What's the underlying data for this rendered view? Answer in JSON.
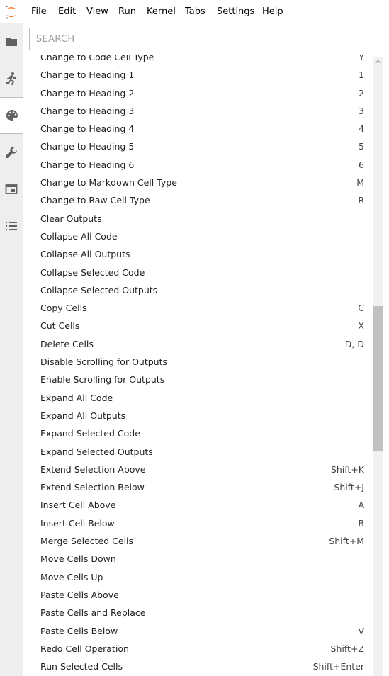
{
  "menubar": {
    "logo_icon": "jupyter-logo-icon",
    "items": [
      "File",
      "Edit",
      "View",
      "Run",
      "Kernel",
      "Tabs",
      "Settings",
      "Help"
    ]
  },
  "sidebar": {
    "tabs": [
      {
        "icon": "folder-icon"
      },
      {
        "icon": "running-icon"
      },
      {
        "icon": "palette-icon",
        "active": true
      },
      {
        "icon": "wrench-icon"
      },
      {
        "icon": "tabs-icon"
      },
      {
        "icon": "list-icon"
      }
    ]
  },
  "palette": {
    "search_placeholder": "SEARCH",
    "commands": [
      {
        "label": "Change to Code Cell Type",
        "shortcut": "Y"
      },
      {
        "label": "Change to Heading 1",
        "shortcut": "1"
      },
      {
        "label": "Change to Heading 2",
        "shortcut": "2"
      },
      {
        "label": "Change to Heading 3",
        "shortcut": "3"
      },
      {
        "label": "Change to Heading 4",
        "shortcut": "4"
      },
      {
        "label": "Change to Heading 5",
        "shortcut": "5"
      },
      {
        "label": "Change to Heading 6",
        "shortcut": "6"
      },
      {
        "label": "Change to Markdown Cell Type",
        "shortcut": "M"
      },
      {
        "label": "Change to Raw Cell Type",
        "shortcut": "R"
      },
      {
        "label": "Clear Outputs",
        "shortcut": ""
      },
      {
        "label": "Collapse All Code",
        "shortcut": ""
      },
      {
        "label": "Collapse All Outputs",
        "shortcut": ""
      },
      {
        "label": "Collapse Selected Code",
        "shortcut": ""
      },
      {
        "label": "Collapse Selected Outputs",
        "shortcut": ""
      },
      {
        "label": "Copy Cells",
        "shortcut": "C"
      },
      {
        "label": "Cut Cells",
        "shortcut": "X"
      },
      {
        "label": "Delete Cells",
        "shortcut": "D, D"
      },
      {
        "label": "Disable Scrolling for Outputs",
        "shortcut": ""
      },
      {
        "label": "Enable Scrolling for Outputs",
        "shortcut": ""
      },
      {
        "label": "Expand All Code",
        "shortcut": ""
      },
      {
        "label": "Expand All Outputs",
        "shortcut": ""
      },
      {
        "label": "Expand Selected Code",
        "shortcut": ""
      },
      {
        "label": "Expand Selected Outputs",
        "shortcut": ""
      },
      {
        "label": "Extend Selection Above",
        "shortcut": "Shift+K"
      },
      {
        "label": "Extend Selection Below",
        "shortcut": "Shift+J"
      },
      {
        "label": "Insert Cell Above",
        "shortcut": "A"
      },
      {
        "label": "Insert Cell Below",
        "shortcut": "B"
      },
      {
        "label": "Merge Selected Cells",
        "shortcut": "Shift+M"
      },
      {
        "label": "Move Cells Down",
        "shortcut": ""
      },
      {
        "label": "Move Cells Up",
        "shortcut": ""
      },
      {
        "label": "Paste Cells Above",
        "shortcut": ""
      },
      {
        "label": "Paste Cells and Replace",
        "shortcut": ""
      },
      {
        "label": "Paste Cells Below",
        "shortcut": "V"
      },
      {
        "label": "Redo Cell Operation",
        "shortcut": "Shift+Z"
      },
      {
        "label": "Run Selected Cells",
        "shortcut": "Shift+Enter"
      }
    ]
  },
  "colors": {
    "accent": "#f37726",
    "sidebar_bg": "#eeeeee",
    "icon": "#616161"
  }
}
